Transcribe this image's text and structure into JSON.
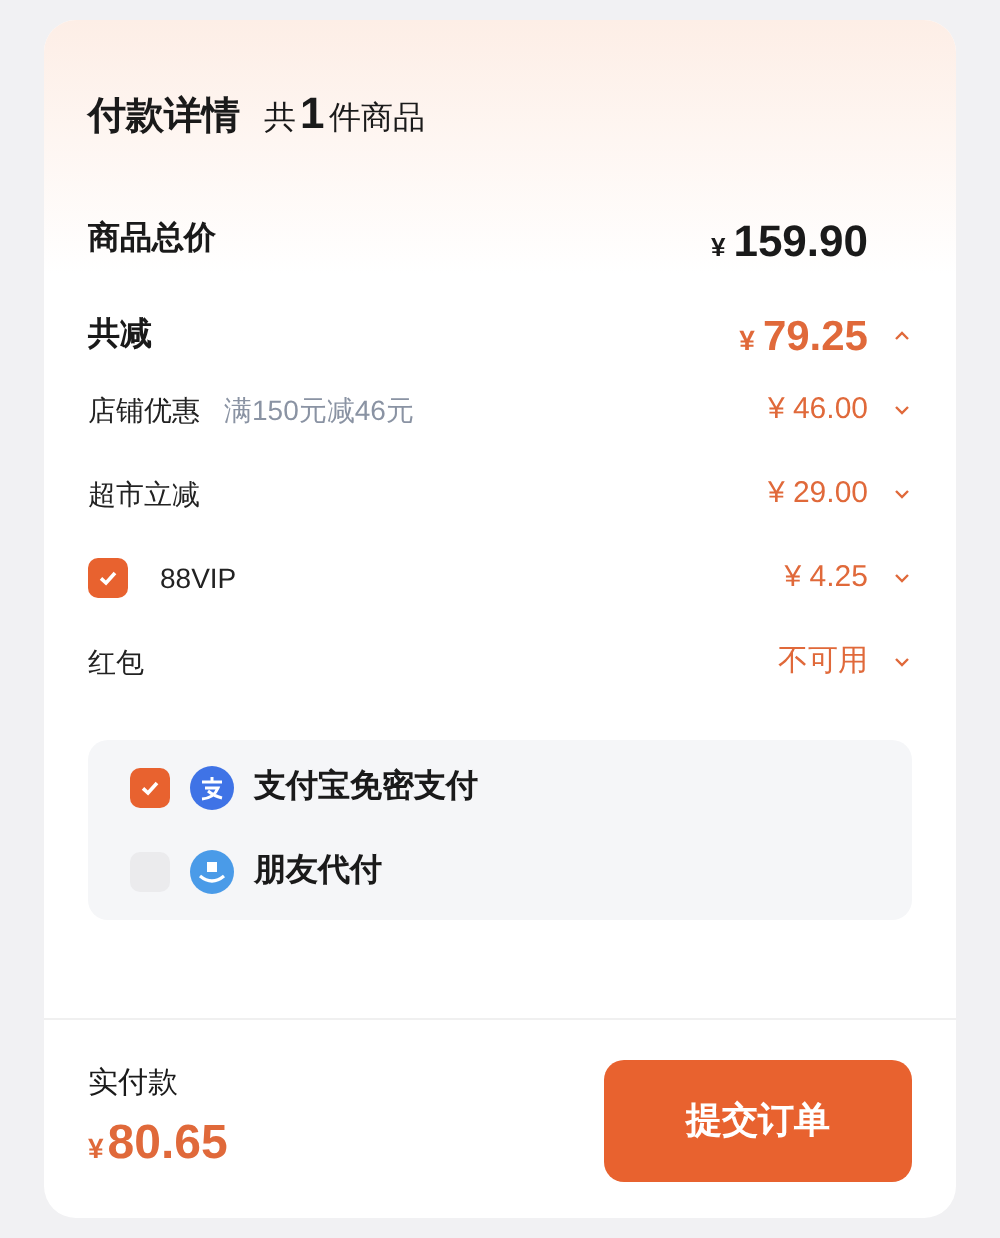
{
  "header": {
    "title": "付款详情",
    "count_prefix": "共",
    "count": "1",
    "count_suffix": "件商品"
  },
  "total": {
    "label": "商品总价",
    "currency": "¥",
    "amount": "159.90"
  },
  "discount": {
    "label": "共减",
    "currency": "¥",
    "amount": "79.25",
    "expanded": true
  },
  "discount_items": [
    {
      "kind": "text",
      "label": "店铺优惠",
      "note": "满150元减46元",
      "value": "¥ 46.00"
    },
    {
      "kind": "text",
      "label": "超市立减",
      "value": "¥ 29.00"
    },
    {
      "kind": "checkbox",
      "label": "88VIP",
      "checked": true,
      "value": "¥ 4.25"
    },
    {
      "kind": "text",
      "label": "红包",
      "value": "不可用"
    }
  ],
  "payment_options": [
    {
      "kind": "alipay",
      "label": "支付宝免密支付",
      "checked": true
    },
    {
      "kind": "friend",
      "label": "朋友代付",
      "checked": false
    }
  ],
  "footer": {
    "label": "实付款",
    "currency": "¥",
    "amount": "80.65",
    "button": "提交订单"
  }
}
